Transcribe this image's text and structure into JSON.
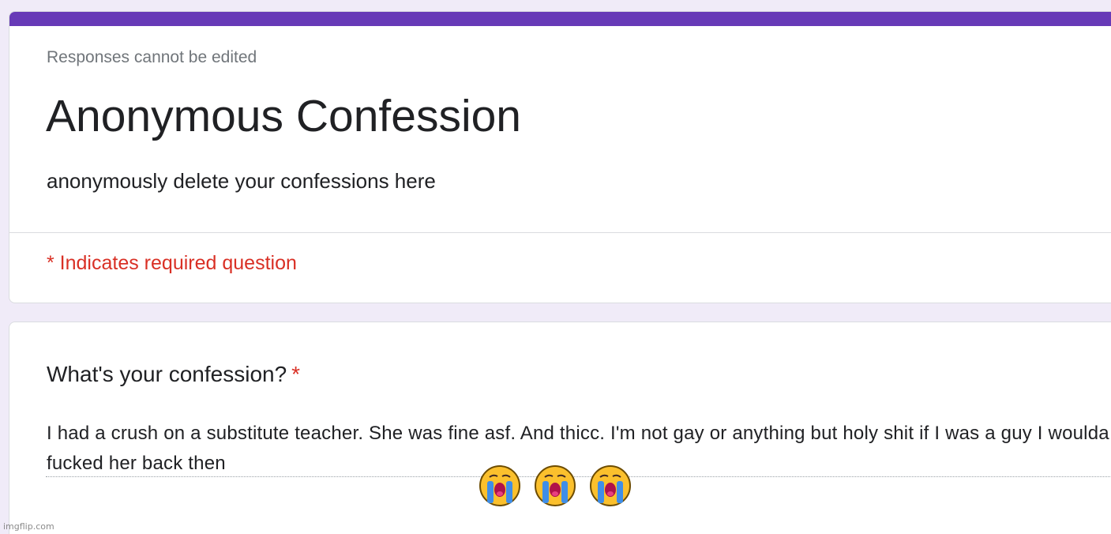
{
  "form": {
    "notice": "Responses cannot be edited",
    "title": "Anonymous Confession",
    "description": "anonymously delete your confessions here",
    "required_note": "* Indicates required question",
    "accent_color": "#673ab7"
  },
  "question": {
    "label": "What's your confession?",
    "required_mark": "*",
    "answer": " I had a crush on a substitute teacher. She was fine asf. And thicc. I'm not gay or anything but holy shit if I was a guy I woulda fucked her back then"
  },
  "overlay": {
    "emojis": [
      "loudly-crying-face",
      "loudly-crying-face",
      "loudly-crying-face"
    ],
    "watermark": "imgflip.com"
  }
}
